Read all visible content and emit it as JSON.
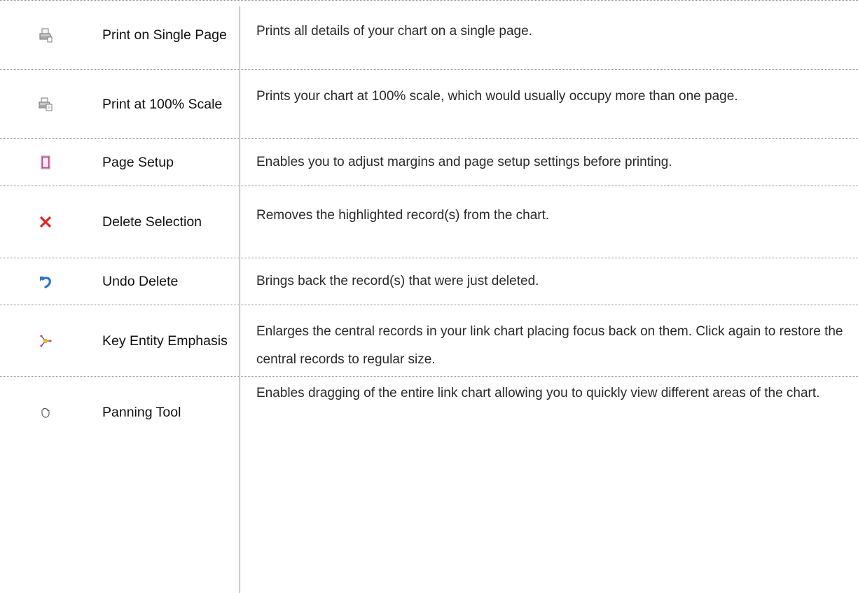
{
  "rows": [
    {
      "icon": "print-single-icon",
      "name": "Print on Single Page",
      "description": "Prints all details of your chart on a single page."
    },
    {
      "icon": "print-100-icon",
      "name": "Print at 100% Scale",
      "description": "Prints your chart at 100% scale, which would usually occupy more than one page."
    },
    {
      "icon": "page-setup-icon",
      "name": "Page Setup",
      "description": "Enables you to adjust margins and page setup settings before printing."
    },
    {
      "icon": "delete-icon",
      "name": "Delete Selection",
      "description": "Removes the highlighted record(s) from the chart."
    },
    {
      "icon": "undo-icon",
      "name": "Undo Delete",
      "description": "Brings back the record(s) that were just deleted."
    },
    {
      "icon": "key-entity-icon",
      "name": "Key Entity Emphasis",
      "description": "Enlarges the central records in your link chart placing focus back on them. Click again to restore the central records to regular size."
    },
    {
      "icon": "hand-icon",
      "name": "Panning Tool",
      "description": "Enables dragging of the entire link chart allowing you to quickly view different areas of the chart."
    }
  ],
  "colors": {
    "delete_red": "#e3261c",
    "undo_blue": "#2f73c9",
    "page_setup_pink": "#d63b9a",
    "rule_gray": "#8a8a8a"
  }
}
